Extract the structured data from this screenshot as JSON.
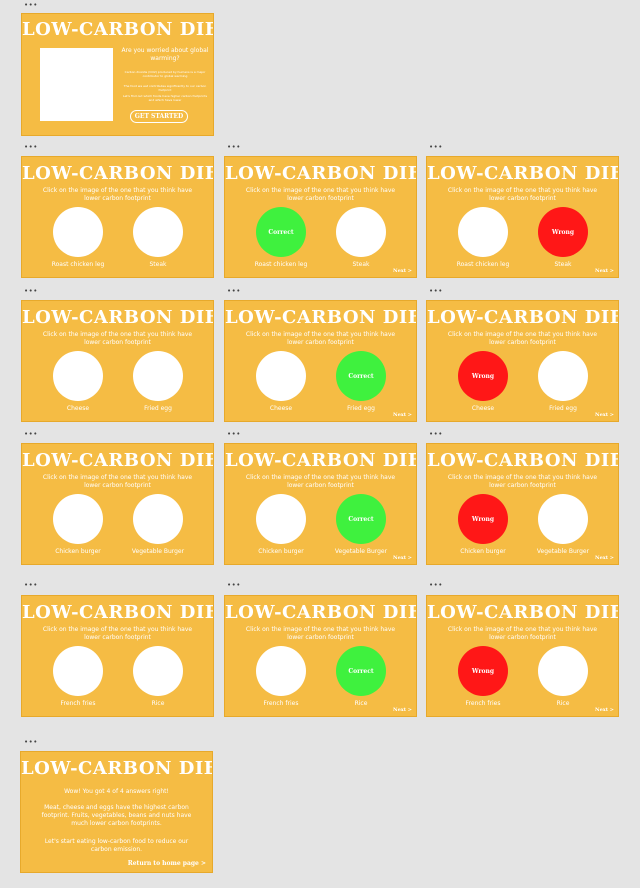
{
  "frame_label": "•••",
  "app_title": "LOW-CARBON DIET",
  "instruction": "Click on the image of the one that you think have lower carbon footprint",
  "next_label": "Next >",
  "correct_label": "Correct",
  "wrong_label": "Wrong",
  "intro": {
    "question": "Are you worried about global warming?",
    "text1": "Carbon dioxide (CO2) produced by humans is a major contributor to global warming",
    "text2": "The food we eat contributes significantly to our carbon footprint",
    "text3": "Let's find out which foods have higher carbon footprints and which have lower",
    "start_label": "GET STARTED"
  },
  "pairs": [
    {
      "left": "Roast chicken leg",
      "right": "Steak"
    },
    {
      "left": "Cheese",
      "right": "Fried egg"
    },
    {
      "left": "Chicken burger",
      "right": "Vegetable Burger"
    },
    {
      "left": "French fries",
      "right": "Rice"
    }
  ],
  "result": {
    "score": "Wow! You got 4 of 4 answers right!",
    "p1": "Meat, cheese and eggs have the highest carbon footprint. Fruits, vegetables, beans and nuts have much lower carbon footprints.",
    "p2": "Let's start eating low-carbon food to reduce our carbon emission.",
    "home_label": "Return to home page >"
  },
  "colors": {
    "card_bg": "#f5bc44",
    "correct": "#3ff13e",
    "wrong": "#ff1717",
    "canvas": "#e4e4e4"
  }
}
